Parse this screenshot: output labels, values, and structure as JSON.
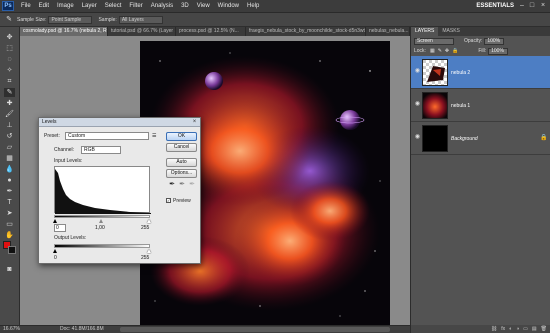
{
  "menubar": {
    "logo": "Ps",
    "items": [
      "File",
      "Edit",
      "Image",
      "Layer",
      "Select",
      "Filter",
      "Analysis",
      "3D",
      "View",
      "Window",
      "Help"
    ],
    "workspace": "ESSENTIALS"
  },
  "options": {
    "sample_size_label": "Sample Size:",
    "sample_size_value": "Point Sample",
    "sample_label": "Sample:",
    "sample_value": "All Layers"
  },
  "tabs": [
    {
      "label": "cosmolady.psd @ 16.7% (nebula 2, RGB/8) *",
      "active": true
    },
    {
      "label": "tutorial.psd @ 66.7% (Layer ...",
      "active": false
    },
    {
      "label": "process.psd @ 12.5% (N...",
      "active": false
    },
    {
      "label": "fraegis_nebula_stock_by_moonchilde_stock-d5n3wt.jpg",
      "active": false
    },
    {
      "label": "nebulas_nebula...",
      "active": false
    }
  ],
  "status": {
    "zoom": "16.67%",
    "doc": "Doc: 41.8M/166.8M"
  },
  "layers_panel": {
    "tab_layers": "LAYERS",
    "tab_masks": "MASKS",
    "blend_mode": "Screen",
    "opacity_label": "Opacity:",
    "opacity_value": "100%",
    "lock_label": "Lock:",
    "fill_label": "Fill:",
    "fill_value": "100%",
    "layers": [
      {
        "name": "nebula 2",
        "active": true
      },
      {
        "name": "nebula 1",
        "active": false
      },
      {
        "name": "Background",
        "active": false
      }
    ]
  },
  "levels": {
    "title": "Levels",
    "preset_label": "Preset:",
    "preset_value": "Custom",
    "channel_label": "Channel:",
    "channel_value": "RGB",
    "input_label": "Input Levels:",
    "input_black": "0",
    "input_gamma": "1,00",
    "input_white": "255",
    "output_label": "Output Levels:",
    "output_black": "0",
    "output_white": "255",
    "ok": "OK",
    "cancel": "Cancel",
    "auto": "Auto",
    "options": "Options...",
    "preview_label": "Preview",
    "preview_checked": true
  },
  "colors": {
    "foreground": "#e01010",
    "background": "#111111",
    "active_layer": "#4d7ec4"
  }
}
